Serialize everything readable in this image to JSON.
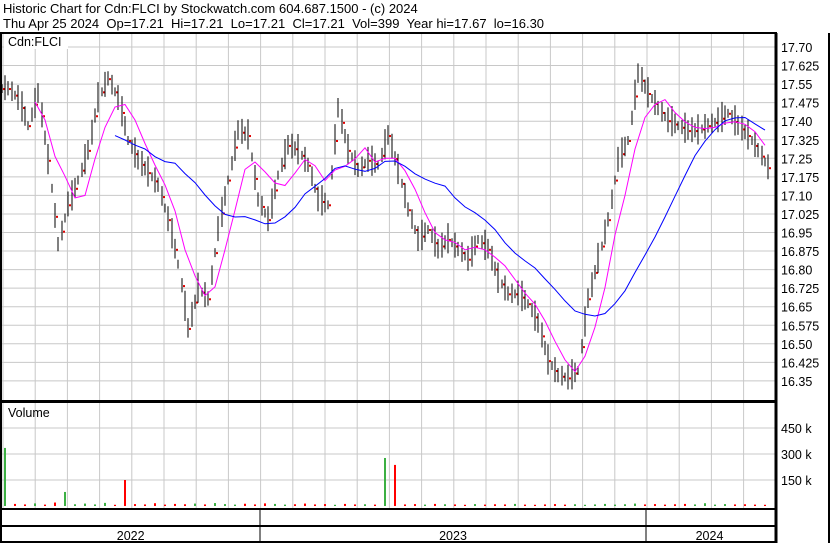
{
  "header": {
    "title": "Historic Chart for Cdn:FLCI by Stockwatch.com 604.687.1500 - (c) 2024",
    "quote": "Thu Apr 25 2024  Op=17.21  Hi=17.21  Lo=17.21  Cl=17.21  Vol=399  Year hi=17.67  lo=16.30"
  },
  "chart_data": {
    "type": "line",
    "symbol_label": "Cdn:FLCI",
    "volume_label": "Volume",
    "price_ylim": [
      16.31,
      17.75
    ],
    "price_ticks": [
      "17.70",
      "17.625",
      "17.55",
      "17.475",
      "17.40",
      "17.325",
      "17.25",
      "17.175",
      "17.10",
      "17.025",
      "16.95",
      "16.875",
      "16.80",
      "16.725",
      "16.65",
      "16.575",
      "16.50",
      "16.425",
      "16.35"
    ],
    "volume_ticks": [
      {
        "label": "450 k",
        "value": 450000
      },
      {
        "label": "300 k",
        "value": 300000
      },
      {
        "label": "150 k",
        "value": 150000
      }
    ],
    "years": [
      {
        "label": "2022",
        "start": 2022.33,
        "end": 2023.0
      },
      {
        "label": "2023",
        "start": 2023.0,
        "end": 2024.0
      },
      {
        "label": "2024",
        "start": 2024.0,
        "end": 2024.33
      }
    ],
    "x_range": [
      2022.33,
      2024.33
    ],
    "closes": [
      17.53,
      17.49,
      17.38,
      17.51,
      17.24,
      16.9,
      17.06,
      17.16,
      17.28,
      17.49,
      17.57,
      17.49,
      17.32,
      17.24,
      17.19,
      17.14,
      17.0,
      16.82,
      16.56,
      16.72,
      16.68,
      16.96,
      17.16,
      17.36,
      17.34,
      17.08,
      17.0,
      17.18,
      17.3,
      17.28,
      17.22,
      17.08,
      17.06,
      17.45,
      17.28,
      17.2,
      17.24,
      17.22,
      17.34,
      17.2,
      17.04,
      16.92,
      16.96,
      16.88,
      16.92,
      16.88,
      16.84,
      16.92,
      16.88,
      16.76,
      16.7,
      16.7,
      16.66,
      16.58,
      16.43,
      16.37,
      16.36,
      16.39,
      16.68,
      16.84,
      17.0,
      17.24,
      17.32,
      17.59,
      17.51,
      17.45,
      17.4,
      17.38,
      17.36,
      17.36,
      17.38,
      17.4,
      17.43,
      17.38,
      17.34,
      17.28,
      17.21
    ],
    "volumes": [
      335000,
      12000,
      9000,
      15000,
      8000,
      20000,
      81000,
      10000,
      14000,
      9000,
      18000,
      7000,
      150000,
      11000,
      9000,
      16000,
      8000,
      12000,
      10000,
      14000,
      9000,
      17000,
      11000,
      8000,
      13000,
      9000,
      15000,
      12000,
      8000,
      10000,
      14000,
      9000,
      11000,
      7000,
      12000,
      9000,
      10000,
      8000,
      277000,
      237000,
      9000,
      11000,
      8000,
      12000,
      10000,
      9000,
      7000,
      11000,
      8000,
      10000,
      9000,
      12000,
      8000,
      7000,
      9000,
      11000,
      8000,
      10000,
      7000,
      9000,
      12000,
      8000,
      10000,
      14000,
      9000,
      11000,
      8000,
      10000,
      12000,
      9000,
      16000,
      8000,
      11000,
      9000,
      10000,
      8000,
      7000
    ],
    "moving_averages": [
      {
        "name": "short",
        "period": 4,
        "color": "#ff00ff"
      },
      {
        "name": "long",
        "period": 12,
        "color": "#0000ff"
      }
    ],
    "colors": {
      "up": "#3cb043",
      "down": "#ff0000",
      "bar": "#000000",
      "grid": "#c8c8c8"
    }
  }
}
